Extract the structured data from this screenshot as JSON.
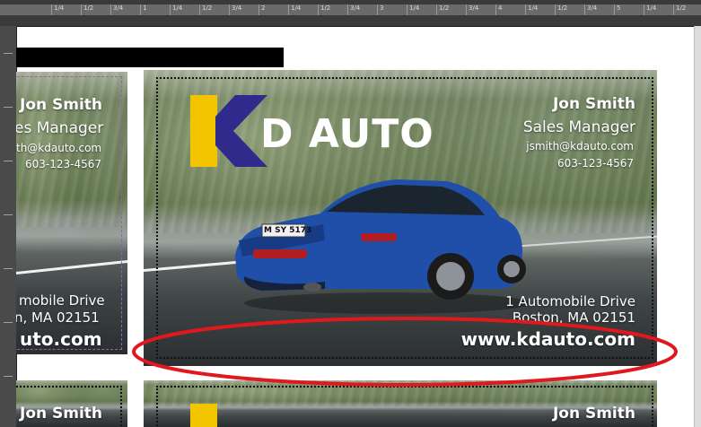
{
  "ruler": {
    "labels": [
      "1/4",
      "1/2",
      "3/4",
      "1",
      "1/4",
      "1/2",
      "3/4",
      "2",
      "1/4",
      "1/2",
      "3/4",
      "3",
      "1/4",
      "1/2",
      "3/4",
      "4",
      "1/4",
      "1/2",
      "3/4",
      "5",
      "1/4",
      "1/2"
    ]
  },
  "card_main": {
    "name": "Jon Smith",
    "title": "Sales Manager",
    "email": "jsmith@kdauto.com",
    "phone": "603-123-4567",
    "address_line1": "1 Automobile Drive",
    "address_line2": "Boston, MA 02151",
    "website": "www.kdauto.com",
    "logo_text": "D AUTO",
    "plate": "M SY 5173"
  },
  "card_left": {
    "name": "Jon Smith",
    "title": "es Manager",
    "email": "th@kdauto.com",
    "phone": "603-123-4567",
    "address_line1": "mobile Drive",
    "address_line2": "n, MA 02151",
    "website": "uto.com"
  },
  "card_bottom_left": {
    "name": "Jon Smith"
  },
  "card_bottom_main": {
    "name": "Jon Smith"
  },
  "colors": {
    "logo_yellow": "#f2c500",
    "logo_blue": "#2f2a8c",
    "annotation_red": "#e0191e",
    "car_blue": "#1f4fa8"
  }
}
